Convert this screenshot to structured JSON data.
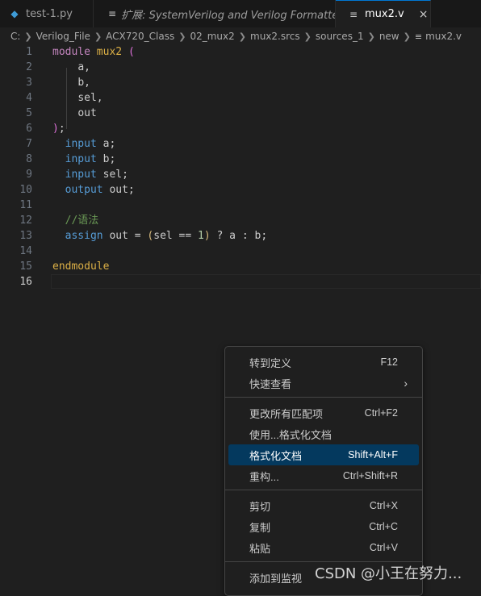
{
  "tabs": [
    {
      "icon": "python-file-icon",
      "label": "test-1.py"
    },
    {
      "icon": "preview-lines-icon",
      "label": "扩展: SystemVerilog and Verilog Formatter"
    },
    {
      "icon": "lines-icon",
      "label": "mux2.v",
      "close": "×"
    }
  ],
  "breadcrumb": [
    "C:",
    "Verilog_File",
    "ACX720_Class",
    "02_mux2",
    "mux2.srcs",
    "sources_1",
    "new",
    "mux2.v"
  ],
  "editor": {
    "line_numbers": [
      "1",
      "2",
      "3",
      "4",
      "5",
      "6",
      "7",
      "8",
      "9",
      "10",
      "11",
      "12",
      "13",
      "14",
      "15",
      "16"
    ],
    "code": {
      "l1_kw": "module",
      "l1_name": "mux2",
      "l1_paren": "(",
      "l2": "a,",
      "l3": "b,",
      "l4": "sel,",
      "l5": "out",
      "l6_paren": ")",
      "l6_semi": ";",
      "l7_kw": "input",
      "l7_rest": " a;",
      "l8_kw": "input",
      "l8_rest": " b;",
      "l9_kw": "input",
      "l9_rest": " sel;",
      "l10_kw": "output",
      "l10_rest": " out;",
      "l12_comment": "//语法",
      "l13_kw": "assign",
      "l13_a": " out = ",
      "l13_p1": "(",
      "l13_b": "sel == ",
      "l13_num": "1",
      "l13_p2": ")",
      "l13_c": " ? a : b;",
      "l15_kw": "endmodule"
    }
  },
  "context_menu": {
    "items": [
      {
        "label": "转到定义",
        "shortcut": "F12"
      },
      {
        "label": "快速查看",
        "shortcut": "",
        "submenu": "›"
      },
      {
        "label": "更改所有匹配项",
        "shortcut": "Ctrl+F2"
      },
      {
        "label": "使用...格式化文档",
        "shortcut": ""
      },
      {
        "label": "格式化文档",
        "shortcut": "Shift+Alt+F",
        "selected": true
      },
      {
        "label": "重构...",
        "shortcut": "Ctrl+Shift+R"
      },
      {
        "label": "剪切",
        "shortcut": "Ctrl+X"
      },
      {
        "label": "复制",
        "shortcut": "Ctrl+C"
      },
      {
        "label": "粘贴",
        "shortcut": "Ctrl+V"
      },
      {
        "label": "添加到监视",
        "shortcut": ""
      }
    ]
  },
  "watermark": "CSDN @小王在努力...",
  "colors": {
    "accent": "#0078d4",
    "selected_bg": "#04395e",
    "keyword": "#c586c0",
    "type_keyword": "#569cd6",
    "module_name": "#dcb046",
    "comment": "#6a9955"
  }
}
